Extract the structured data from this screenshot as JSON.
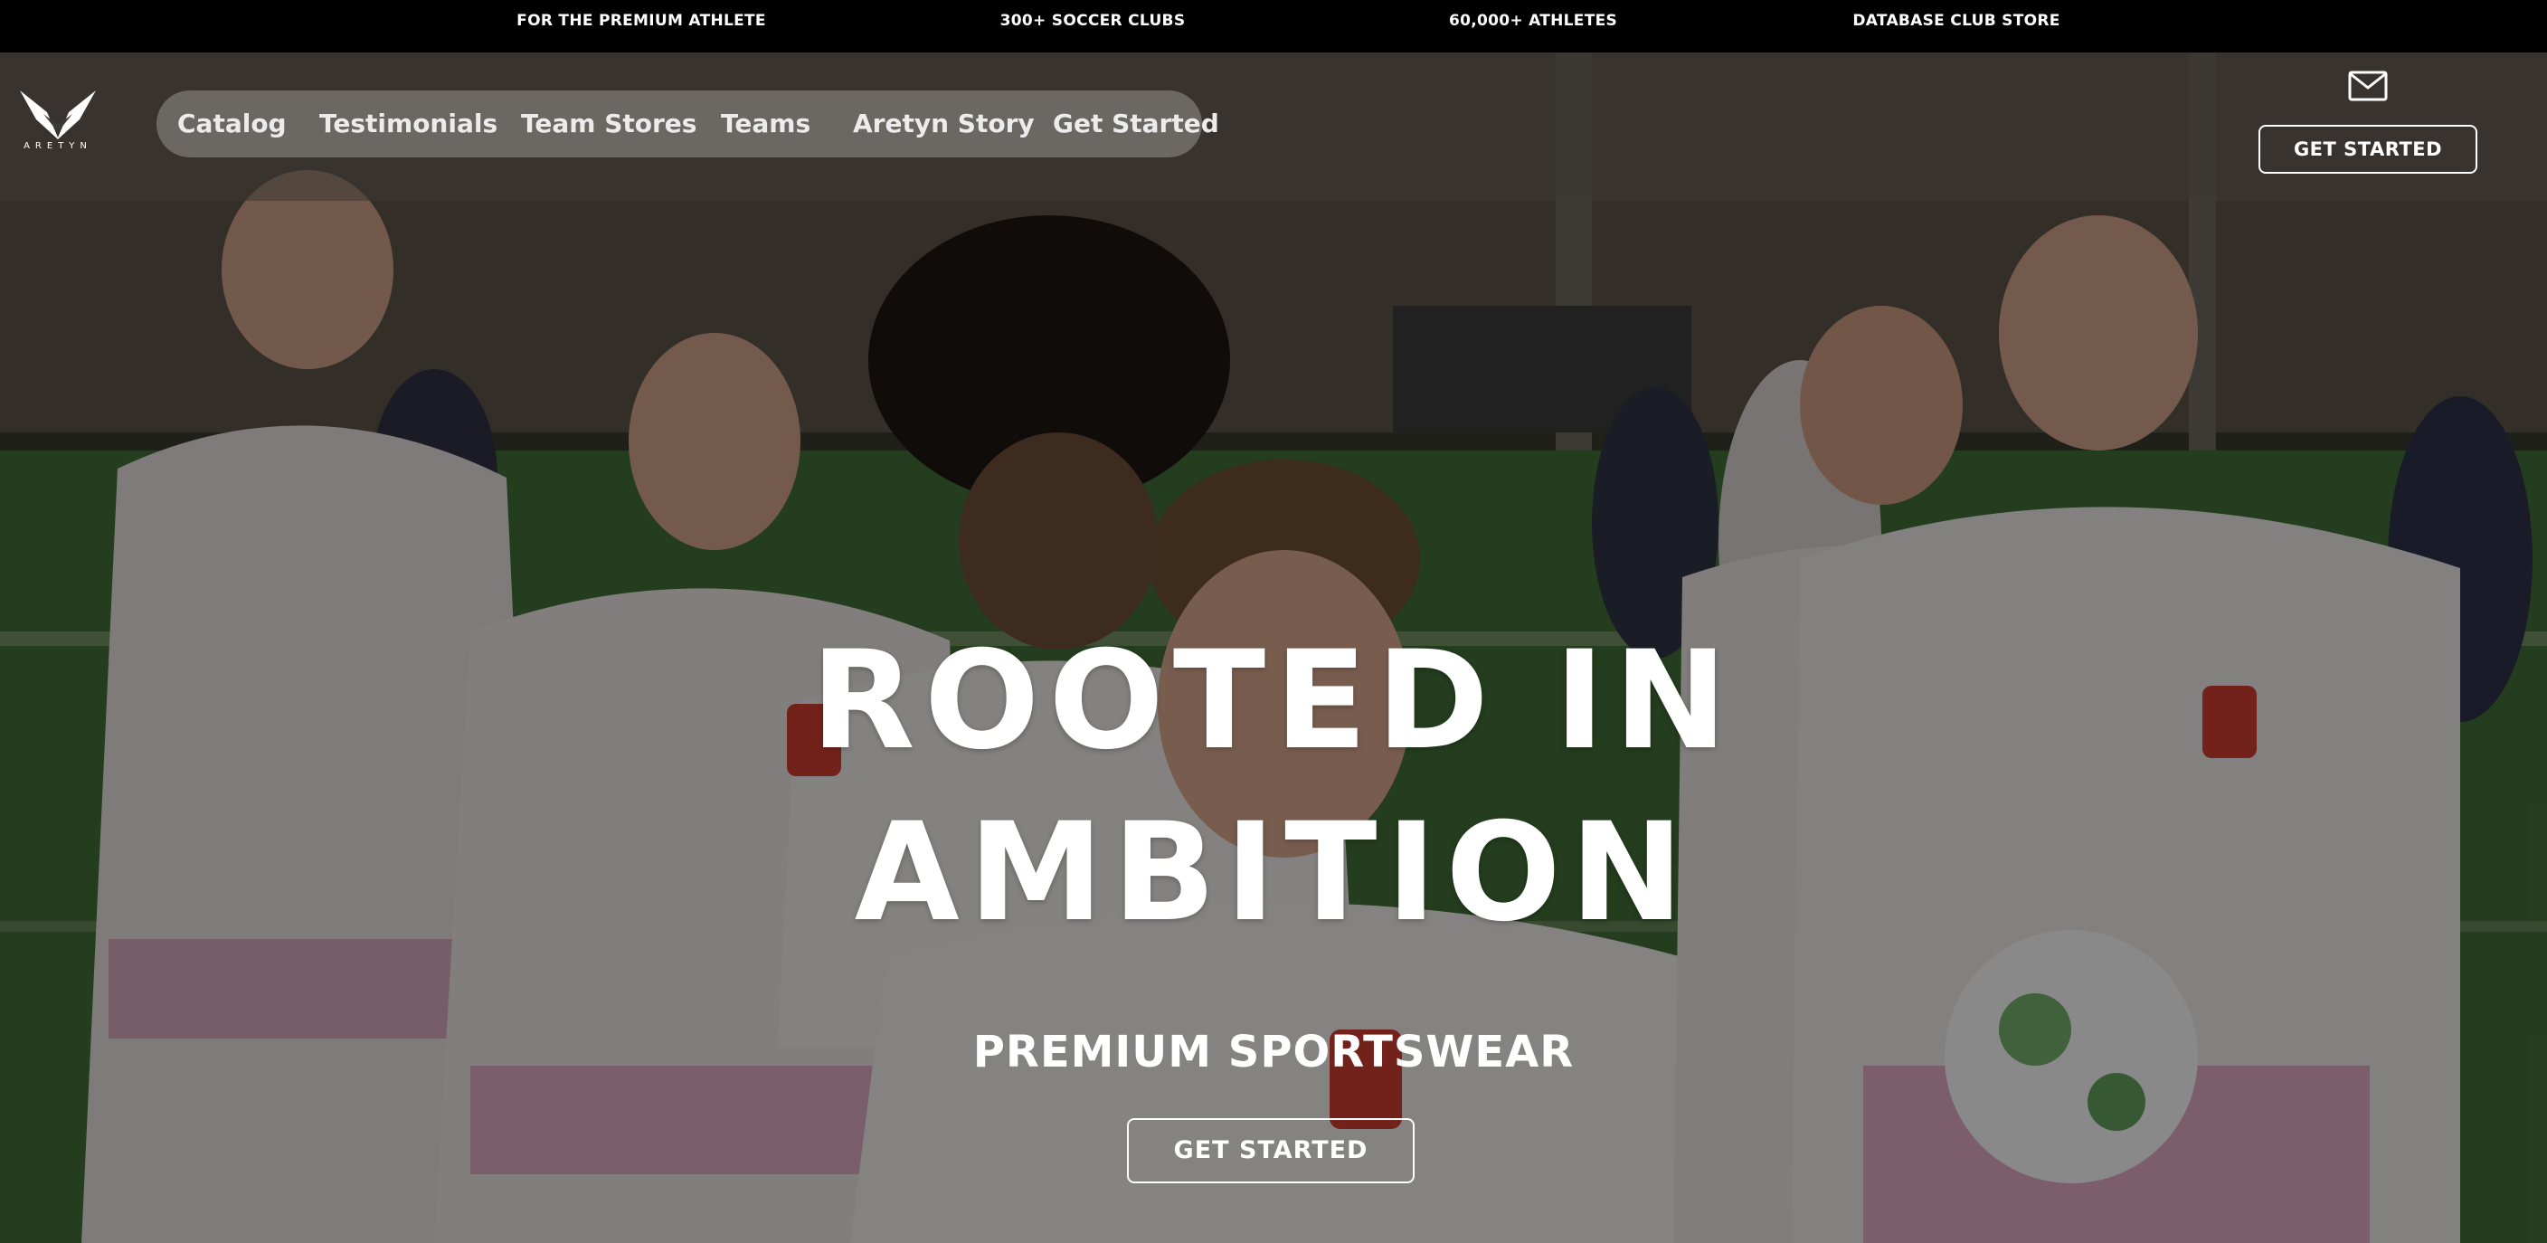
{
  "topbar": {
    "items": [
      "FOR THE PREMIUM ATHLETE",
      "300+ SOCCER CLUBS",
      "60,000+ ATHLETES",
      "DATABASE CLUB STORE"
    ]
  },
  "header": {
    "logo_text": "ARETYN",
    "nav": [
      "Catalog",
      "Testimonials",
      "Team Stores",
      "Teams",
      "Aretyn Story",
      "Get Started"
    ],
    "cta_label": "GET STARTED",
    "mail_icon": "mail-icon"
  },
  "hero": {
    "headline_line1": "ROOTED IN",
    "headline_line2": "AMBITION",
    "subheadline": "PREMIUM SPORTSWEAR",
    "cta_label": "GET STARTED",
    "background": "soccer players in white jerseys celebrating on a pitch"
  },
  "colors": {
    "topbar_bg": "#000000",
    "text": "#ffffff",
    "nav_pill": "#96928e",
    "jersey_pink": "#e8a6c4"
  }
}
